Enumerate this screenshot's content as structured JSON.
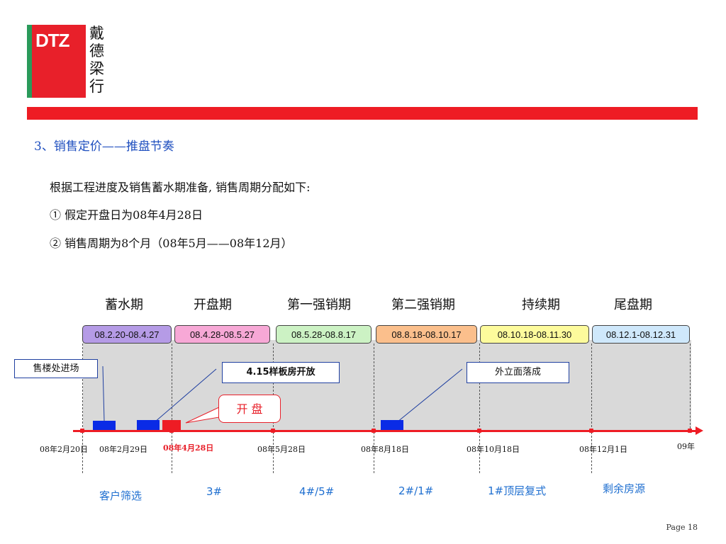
{
  "logo": {
    "brand": "DTZ",
    "cn_chars": [
      "戴",
      "德",
      "梁",
      "行"
    ]
  },
  "title": "3、销售定价——推盘节奏",
  "intro": {
    "line1": "根据工程进度及销售蓄水期准备, 销售周期分配如下:",
    "line2": "①  假定开盘日为08年4月28日",
    "line3": "②  销售周期为8个月（08年5月——08年12月）"
  },
  "phases": [
    {
      "name": "蓄水期",
      "range": "08.2.20-08.4.27",
      "color": "#b59be6"
    },
    {
      "name": "开盘期",
      "range": "08.4.28-08.5.27",
      "color": "#f7a8d6"
    },
    {
      "name": "第一强销期",
      "range": "08.5.28-08.8.17",
      "color": "#ccf2c4"
    },
    {
      "name": "第二强销期",
      "range": "08.8.18-08.10.17",
      "color": "#fbbf8c"
    },
    {
      "name": "持续期",
      "range": "08.10.18-08.11.30",
      "color": "#fdfb9c"
    },
    {
      "name": "尾盘期",
      "range": "08.12.1-08.12.31",
      "color": "#cfe8fb"
    }
  ],
  "callouts": {
    "sales_office": "售楼处进场",
    "showflat": "4.15样板房开放",
    "facade": "外立面落成",
    "opening": "开 盘"
  },
  "dates": {
    "d1": "08年2月20日",
    "d2": "08年2月29日",
    "d3": "08年4月28日",
    "d4": "08年5月28日",
    "d5": "08年8月18日",
    "d6": "08年10月18日",
    "d7": "08年12月1日",
    "d8": "09年"
  },
  "bottom_labels": {
    "b1": "客户筛选",
    "b2": "3#",
    "b3": "4#/5#",
    "b4": "2#/1#",
    "b5": "1#顶层复式",
    "b6": "剩余房源"
  },
  "page_label": "Page 18",
  "colors": {
    "accent_red": "#ee1c24",
    "title_blue": "#1f4fbf",
    "block_blue": "#0a2be6",
    "label_blue": "#1f6fd0"
  }
}
